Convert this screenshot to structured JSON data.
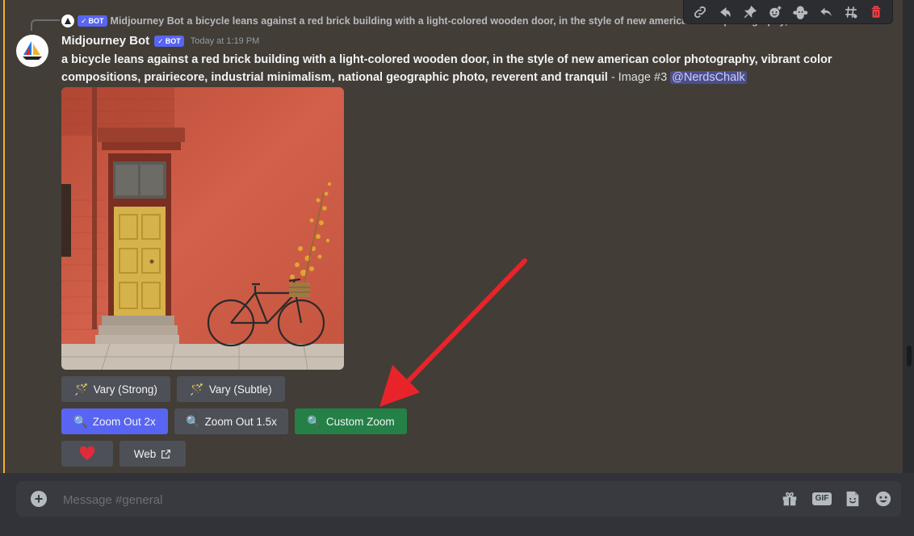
{
  "reply": {
    "author": "Midjourney Bot",
    "bot_tag": "BOT",
    "text": "a bicycle leans against a red brick building with a light-colored wooden door, in the style of new american color photography, vibrant"
  },
  "toolbar": {
    "icons": [
      "link-icon",
      "forward-icon",
      "pin-icon",
      "add-reaction-icon",
      "apps-icon",
      "reply-icon",
      "thread-icon",
      "delete-icon"
    ]
  },
  "message": {
    "author": "Midjourney Bot",
    "bot_tag": "BOT",
    "timestamp": "Today at 1:19 PM",
    "prompt": "a bicycle leans against a red brick building with a light-colored wooden door, in the style of new american color photography, vibrant color compositions, prairiecore, industrial minimalism, national geographic photo, reverent and tranquil",
    "suffix": " - Image #3 ",
    "mention": "@NerdsChalk"
  },
  "buttons": {
    "vary_strong": "Vary (Strong)",
    "vary_subtle": "Vary (Subtle)",
    "zoom_out_2x": "Zoom Out 2x",
    "zoom_out_1_5x": "Zoom Out 1.5x",
    "custom_zoom": "Custom Zoom",
    "web": "Web"
  },
  "composer": {
    "placeholder": "Message #general",
    "icons": [
      "gift-icon",
      "gif-icon",
      "sticker-icon",
      "emoji-icon"
    ],
    "gif_label": "GIF"
  },
  "colors": {
    "accent": "#5865f2",
    "green": "#248046",
    "grey_button": "#4e5058",
    "highlight_bar": "#f0b232",
    "annotation_arrow": "#e8232a"
  }
}
